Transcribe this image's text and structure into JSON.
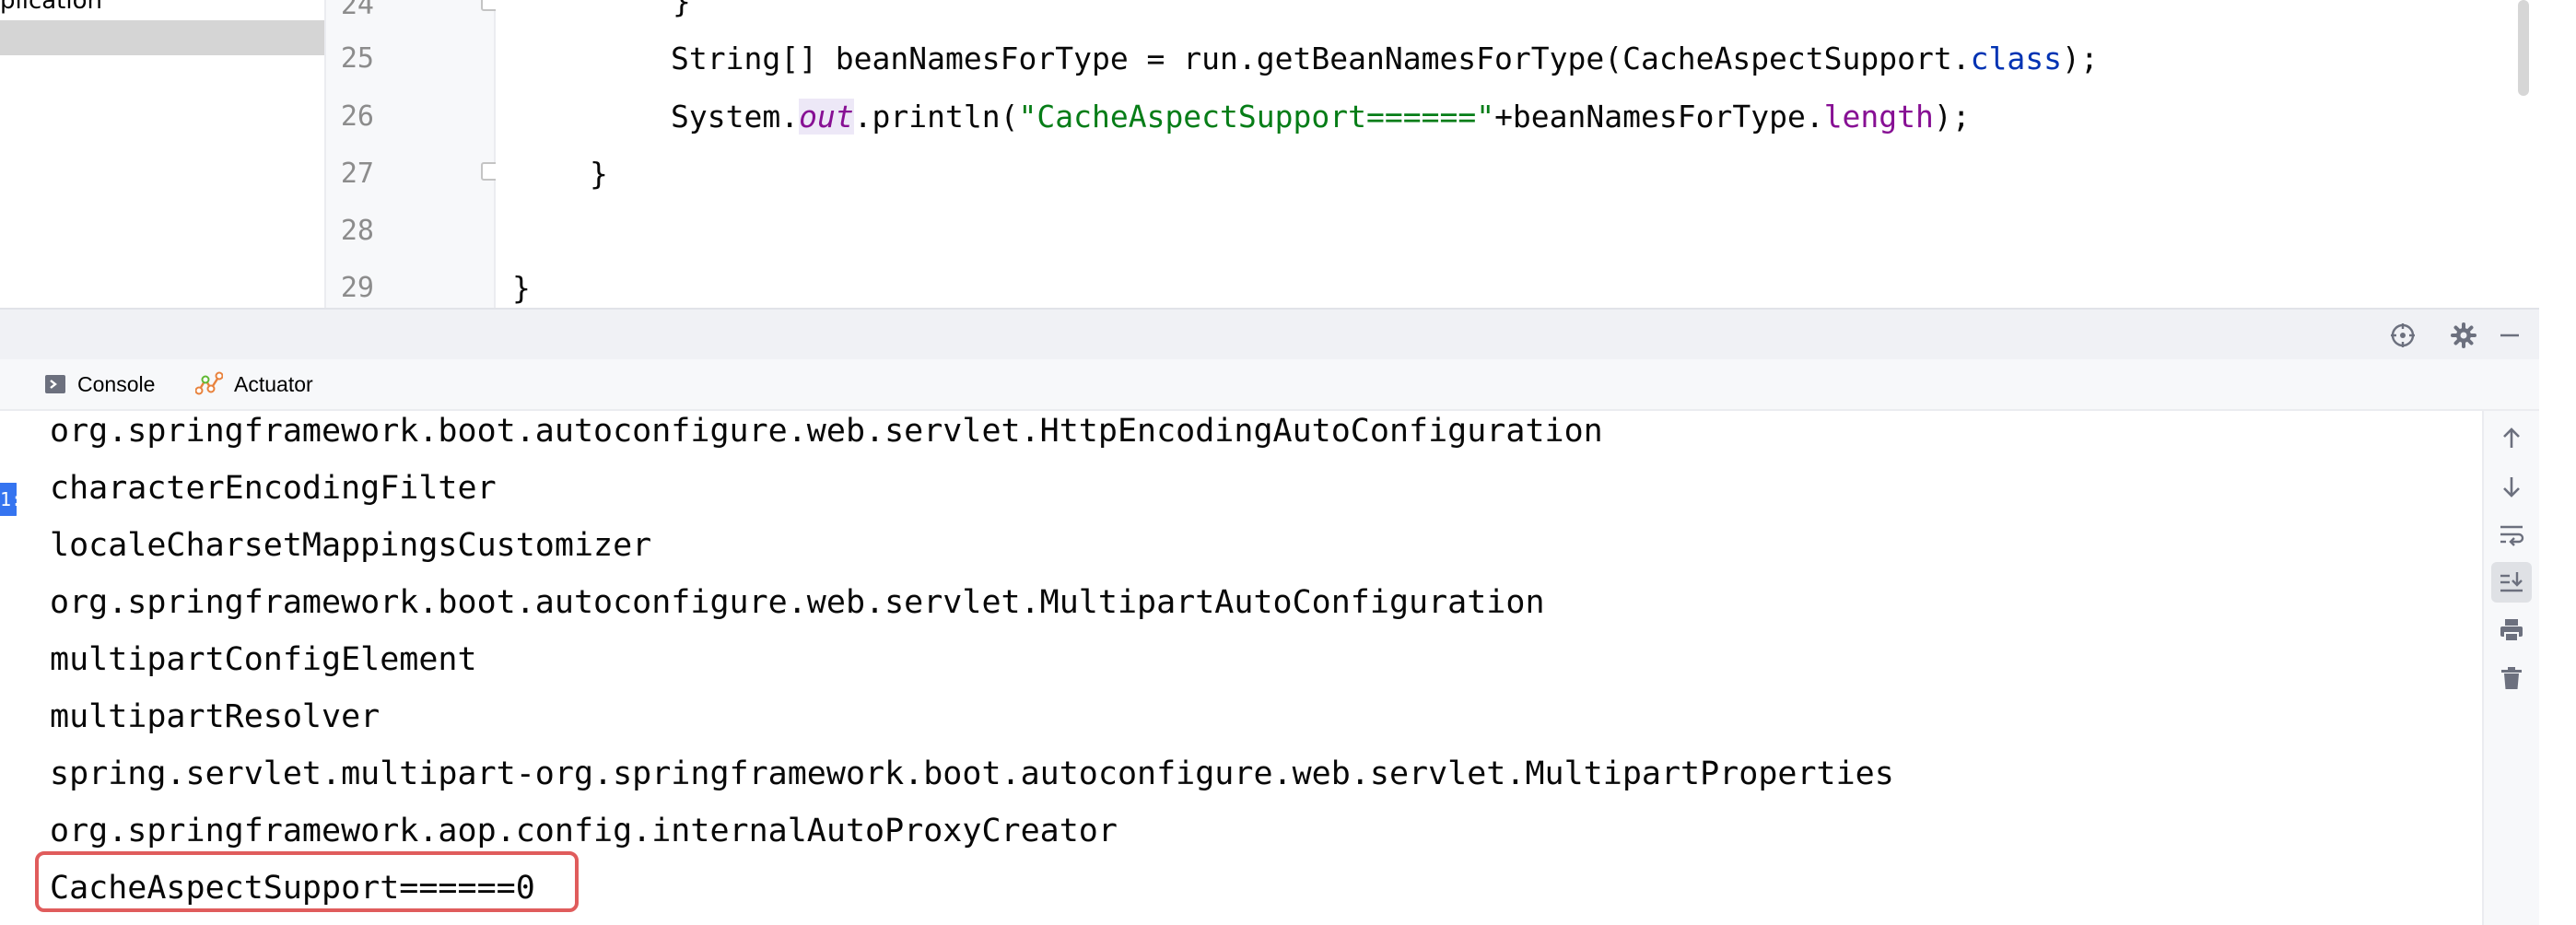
{
  "project_tree": {
    "partial_item": "plication"
  },
  "editor": {
    "line_numbers": [
      "24",
      "25",
      "26",
      "27",
      "28",
      "29"
    ],
    "line24": "}",
    "line25": {
      "a": "String[] beanNamesForType = run.getBeanNamesForType(CacheAspectSupport.",
      "kw": "class",
      "b": ");"
    },
    "line26": {
      "a": "System.",
      "static_field": "out",
      "b": ".println(",
      "str": "\"CacheAspectSupport======\"",
      "c": "+beanNamesForType.",
      "field": "length",
      "d": ");"
    },
    "line27": "}",
    "line29": "}"
  },
  "tabs": [
    {
      "label": "Console",
      "icon": "console-icon"
    },
    {
      "label": "Actuator",
      "icon": "actuator-icon"
    }
  ],
  "console": {
    "left_badge": "1:",
    "lines": [
      "org.springframework.boot.autoconfigure.web.servlet.HttpEncodingAutoConfiguration",
      "characterEncodingFilter",
      "localeCharsetMappingsCustomizer",
      "org.springframework.boot.autoconfigure.web.servlet.MultipartAutoConfiguration",
      "multipartConfigElement",
      "multipartResolver",
      "spring.servlet.multipart-org.springframework.boot.autoconfigure.web.servlet.MultipartProperties",
      "org.springframework.aop.config.internalAutoProxyCreator",
      "CacheAspectSupport======0"
    ],
    "highlighted_line_index": 8
  },
  "colors": {
    "highlight": "#e05c5c",
    "keyword": "#0033b3",
    "field": "#871094",
    "string": "#067d17",
    "badge": "#3574f0"
  },
  "icons": {
    "header": [
      "crosshair-icon",
      "gear-icon",
      "minimize-icon"
    ],
    "console_toolbar": [
      "arrow-up-icon",
      "arrow-down-icon",
      "soft-wrap-icon",
      "scroll-to-end-icon",
      "print-icon",
      "trash-icon"
    ]
  }
}
